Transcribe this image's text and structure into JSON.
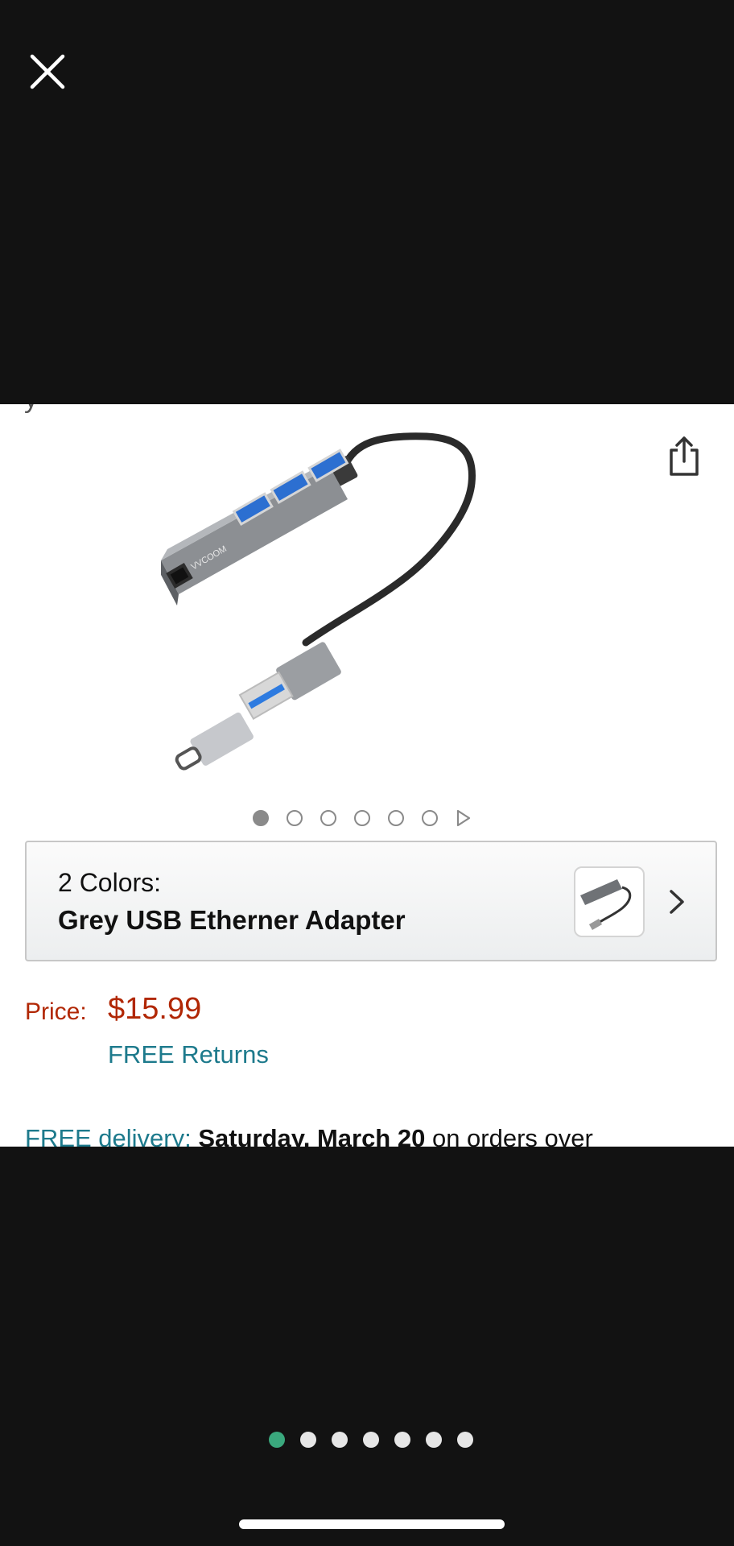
{
  "card": {
    "cut_text": "y",
    "image_alt": "Grey USB hub with Ethernet port and USB-C adapter",
    "brand_mark": "VVCOOM"
  },
  "carousel": {
    "dots": [
      true,
      false,
      false,
      false,
      false,
      false
    ],
    "has_video": true
  },
  "colors": {
    "count_label": "2 Colors:",
    "selected_name": "Grey USB Etherner Adapter"
  },
  "price": {
    "label": "Price:",
    "value": "$15.99",
    "returns": "FREE Returns"
  },
  "delivery": {
    "label": "FREE delivery:",
    "date": "Saturday, March 20",
    "suffix": " on orders over"
  },
  "viewer": {
    "page_dots": [
      true,
      false,
      false,
      false,
      false,
      false,
      false
    ]
  },
  "colors_palette": {
    "background": "#121212",
    "price": "#b12704",
    "link": "#1d7a8c",
    "active_dot": "#3aa87d"
  }
}
